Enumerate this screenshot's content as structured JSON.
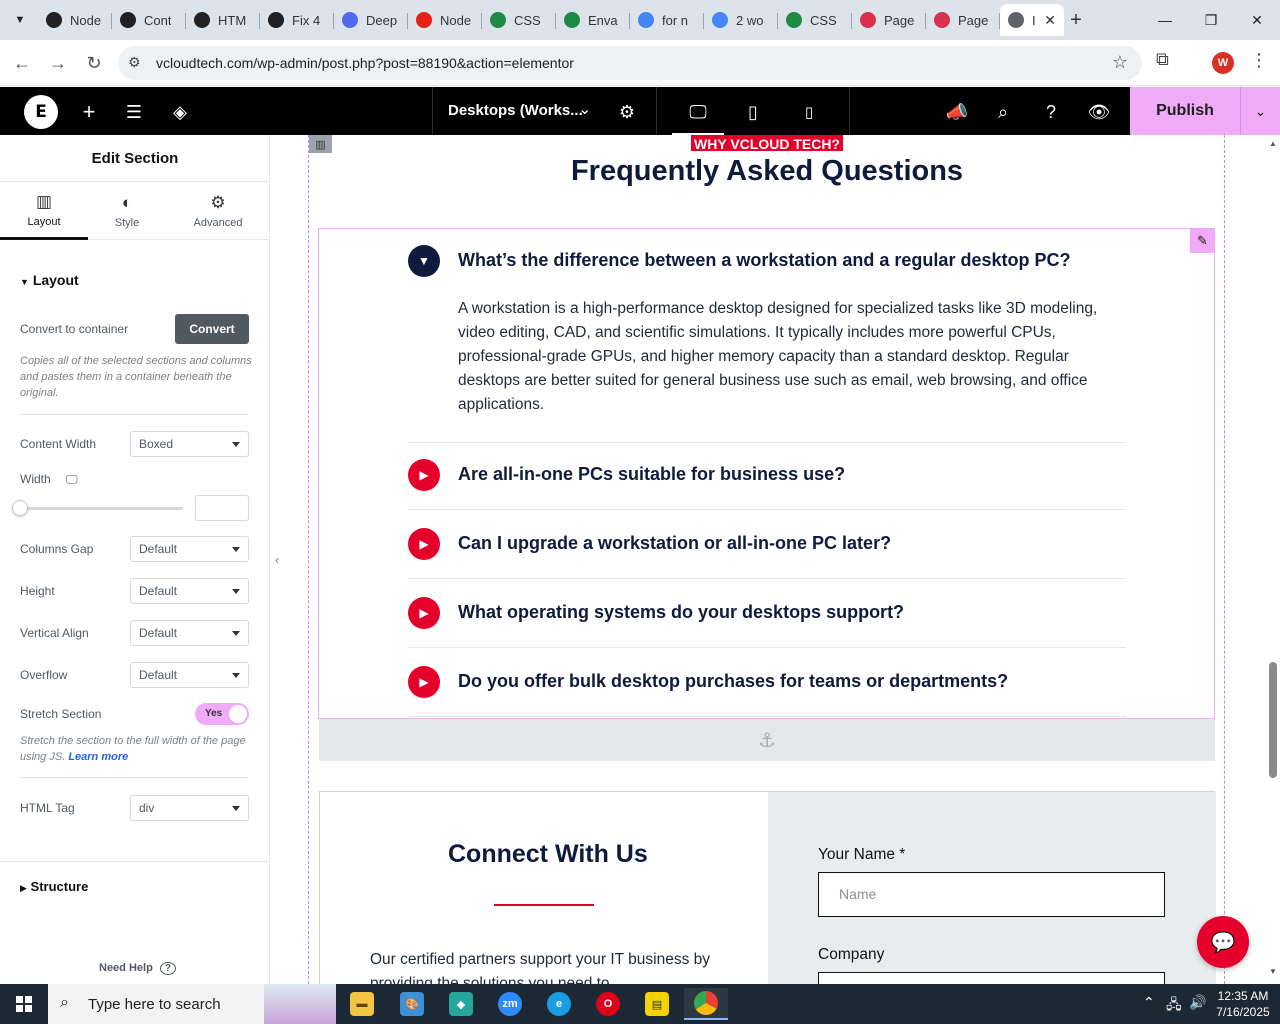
{
  "browser": {
    "tabs": [
      {
        "label": "Node",
        "color": "#202124"
      },
      {
        "label": "Cont",
        "color": "#202124"
      },
      {
        "label": "HTM",
        "color": "#202124"
      },
      {
        "label": "Fix 4",
        "color": "#202124"
      },
      {
        "label": "Deep",
        "color": "#4f6bed"
      },
      {
        "label": "Node",
        "color": "#e62117"
      },
      {
        "label": "CSS",
        "color": "#1e8a44"
      },
      {
        "label": "Enva",
        "color": "#1e8a44"
      },
      {
        "label": "for n",
        "color": "#4285f4"
      },
      {
        "label": "2 wo",
        "color": "#4285f4"
      },
      {
        "label": "CSS",
        "color": "#1e8a44"
      },
      {
        "label": "Page",
        "color": "#d9304f"
      },
      {
        "label": "Page",
        "color": "#d9304f"
      },
      {
        "label": "I",
        "color": "#5f6368"
      }
    ],
    "url": "vcloudtech.com/wp-admin/post.php?post=88190&action=elementor",
    "profile_initial": "W"
  },
  "elementor": {
    "document_name": "Desktops (Works...",
    "publish_label": "Publish"
  },
  "panel": {
    "title": "Edit Section",
    "tabs": [
      {
        "label": "Layout"
      },
      {
        "label": "Style"
      },
      {
        "label": "Advanced"
      }
    ],
    "layout_heading": "Layout",
    "convert_label": "Convert to container",
    "convert_button": "Convert",
    "convert_help": "Copies all of the selected sections and columns and pastes them in a container beneath the original.",
    "content_width_label": "Content Width",
    "content_width_value": "Boxed",
    "width_label": "Width",
    "columns_gap_label": "Columns Gap",
    "columns_gap_value": "Default",
    "height_label": "Height",
    "height_value": "Default",
    "vertical_align_label": "Vertical Align",
    "vertical_align_value": "Default",
    "overflow_label": "Overflow",
    "overflow_value": "Default",
    "stretch_label": "Stretch Section",
    "stretch_value": "Yes",
    "stretch_help": "Stretch the section to the full width of the page using JS.",
    "learn_more": "Learn more",
    "html_tag_label": "HTML Tag",
    "html_tag_value": "div",
    "structure_heading": "Structure",
    "need_help": "Need Help"
  },
  "canvas": {
    "eyebrow": "WHY VCLOUD TECH?",
    "faq_title": "Frequently Asked Questions",
    "faq": [
      {
        "question": "What’s the difference between a workstation and a regular desktop PC?",
        "open": true
      },
      {
        "question": "Are all-in-one PCs suitable for business use?",
        "open": false
      },
      {
        "question": "Can I upgrade a workstation or all-in-one PC later?",
        "open": false
      },
      {
        "question": "What operating systems do your desktops support?",
        "open": false
      },
      {
        "question": "Do you offer bulk desktop purchases for teams or departments?",
        "open": false
      }
    ],
    "faq_answer": "A workstation is a high-performance desktop designed for specialized tasks like 3D modeling, video editing, CAD, and scientific simulations. It typically includes more powerful CPUs, professional-grade GPUs, and higher memory capacity than a standard desktop. Regular desktops are better suited for general business use such as email, web browsing, and office applications.",
    "connect_title": "Connect With Us",
    "connect_text": "Our certified partners support your IT business by providing the solutions you need to",
    "form": {
      "name_label": "Your Name *",
      "name_placeholder": "Name",
      "company_label": "Company"
    }
  },
  "taskbar": {
    "search_placeholder": "Type here to search",
    "time": "12:35 AM",
    "date": "7/16/2025"
  },
  "colors": {
    "accent_red": "#e4002b",
    "navy": "#0f1b3d",
    "elementor_pink": "#f0abf8"
  }
}
